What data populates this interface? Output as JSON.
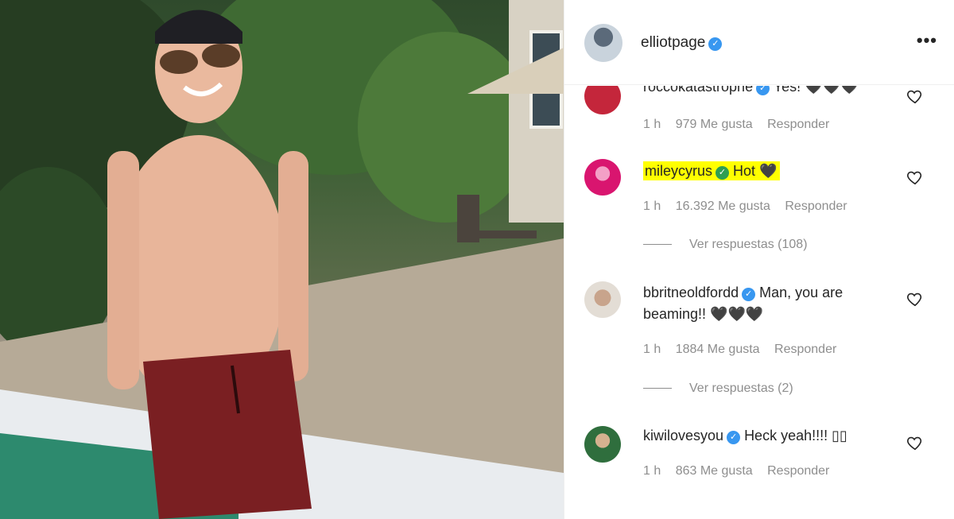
{
  "post": {
    "author": "elliotpage",
    "more_icon": "more-horizontal-icon"
  },
  "comments": [
    {
      "user": "roccokatastrophe",
      "text": "Yes! 🖤🖤🖤",
      "time": "1 h",
      "likes": "979 Me gusta",
      "reply": "Responder",
      "avatar_color": "#c4263b"
    },
    {
      "user": "mileycyrus",
      "text": "Hot 🖤",
      "time": "1 h",
      "likes": "16.392 Me gusta",
      "reply": "Responder",
      "view_replies": "Ver respuestas (108)",
      "avatar_color": "#d9156f"
    },
    {
      "user": "bbritneoldfordd",
      "text": "Man, you are beaming!! 🖤🖤🖤",
      "time": "1 h",
      "likes": "1884 Me gusta",
      "reply": "Responder",
      "view_replies": "Ver respuestas (2)",
      "avatar_color": "#e3ddd5"
    },
    {
      "user": "kiwilovesyou",
      "text": "Heck yeah!!!! ▯▯",
      "time": "1 h",
      "likes": "863 Me gusta",
      "reply": "Responder",
      "avatar_color": "#2f6e3d"
    }
  ],
  "colors": {
    "verified_blue": "#3897f0",
    "verified_green": "#2e9e52",
    "highlight": "#ffff00",
    "meta_gray": "#8e8e8e"
  }
}
